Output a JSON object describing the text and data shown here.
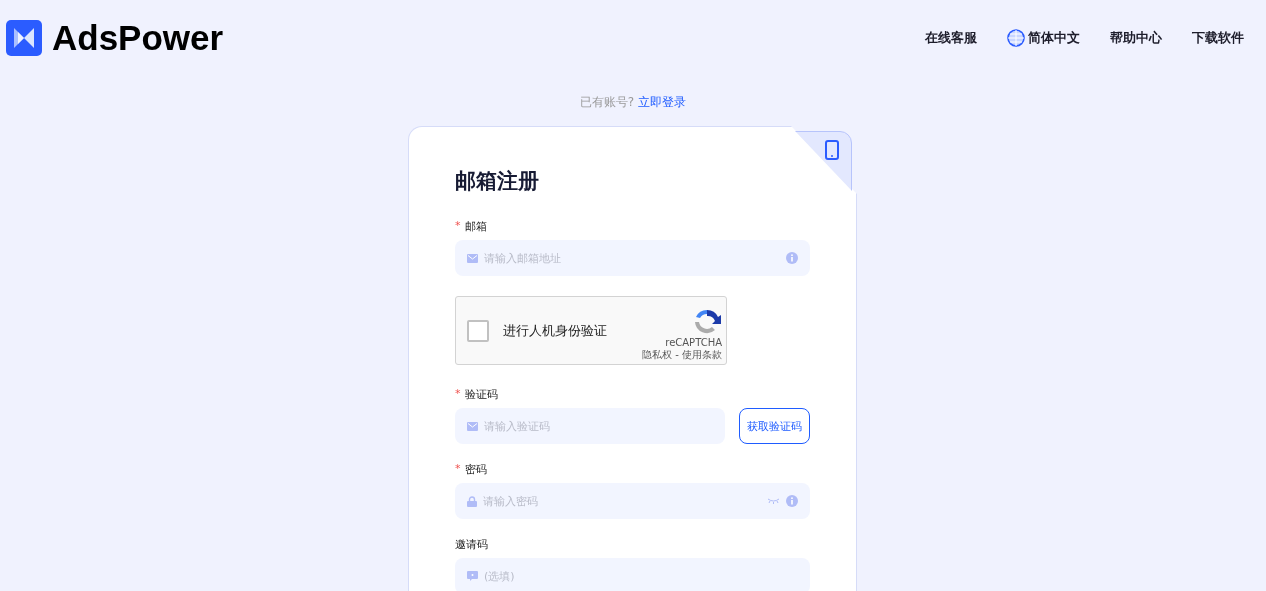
{
  "header": {
    "logo": "AdsPower",
    "nav": [
      {
        "label": "在线客服",
        "kind": "text"
      },
      {
        "label": "简体中文",
        "kind": "language"
      },
      {
        "label": "帮助中心",
        "kind": "text"
      },
      {
        "label": "下载软件",
        "kind": "text"
      }
    ]
  },
  "login_prompt": {
    "text": "已有账号?",
    "link": "立即登录"
  },
  "form": {
    "title": "邮箱注册",
    "fields": [
      {
        "kind": "email",
        "label": "邮箱",
        "mark": "*",
        "placeholder": "请输入邮箱地址"
      },
      {
        "kind": "captcha",
        "checked": false,
        "label": "进行人机身份验证",
        "brand": "reCAPTCHA",
        "links": "隐私权 - 使用条款"
      },
      {
        "kind": "code",
        "label": "验证码",
        "mark": "*",
        "placeholder": "请输入验证码",
        "button": "获取验证码"
      },
      {
        "kind": "password",
        "label": "密码",
        "mark": "*",
        "placeholder": "请输入密码"
      },
      {
        "kind": "invite",
        "label": "邀请码",
        "placeholder": "(选填)"
      }
    ]
  }
}
